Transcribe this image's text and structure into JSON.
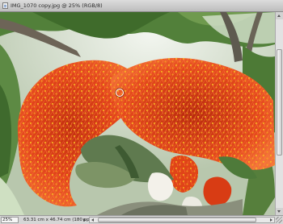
{
  "window": {
    "title": "IMG_1070 copy.jpg @ 25% (RGB/8)",
    "doc_icon": "image-document-icon"
  },
  "canvas": {
    "cursor_icon": "circle-brush-cursor-icon",
    "colors": {
      "flower": "#e8451a",
      "stamen_tip": "#f4c21c",
      "leaf": "#3e6b2a",
      "sky": "#e9efe6"
    }
  },
  "status": {
    "zoom": "25%",
    "doc_info": "63.31 cm x 46.74 cm (180 ppi)"
  },
  "scrollbars": {
    "vertical": {
      "up_icon": "arrow-up-icon",
      "down_icon": "arrow-down-icon",
      "position": 0.33
    },
    "horizontal": {
      "left_icon": "arrow-left-icon",
      "right_icon": "arrow-right-icon",
      "position": 0.0
    }
  }
}
